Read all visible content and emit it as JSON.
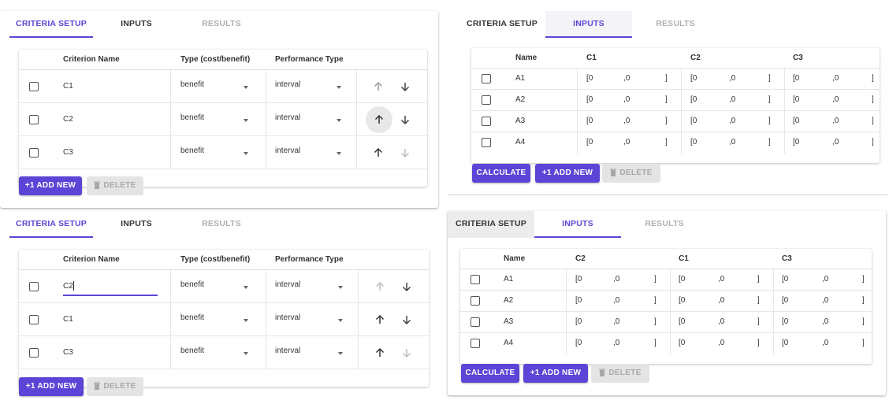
{
  "tabs": {
    "criteria_setup": "CRITERIA SETUP",
    "inputs": "INPUTS",
    "results": "RESULTS"
  },
  "criteria_table": {
    "headers": [
      "Criterion Name",
      "Type (cost/benefit)",
      "Performance Type"
    ]
  },
  "panel_tl": {
    "rows": [
      {
        "name": "C1",
        "type": "benefit",
        "perf": "interval"
      },
      {
        "name": "C2",
        "type": "benefit",
        "perf": "interval"
      },
      {
        "name": "C3",
        "type": "benefit",
        "perf": "interval"
      }
    ]
  },
  "panel_bl": {
    "rows": [
      {
        "name": "C2",
        "type": "benefit",
        "perf": "interval"
      },
      {
        "name": "C1",
        "type": "benefit",
        "perf": "interval"
      },
      {
        "name": "C3",
        "type": "benefit",
        "perf": "interval"
      }
    ]
  },
  "panel_tr": {
    "headers": [
      "Name",
      "C1",
      "C2",
      "C3"
    ],
    "rows": [
      "A1",
      "A2",
      "A3",
      "A4"
    ]
  },
  "panel_br": {
    "headers": [
      "Name",
      "C2",
      "C1",
      "C3"
    ],
    "rows": [
      "A1",
      "A2",
      "A3",
      "A4"
    ]
  },
  "interval": {
    "open": "[0",
    "sep": ",0",
    "close": "]"
  },
  "buttons": {
    "add_new": "+1  ADD NEW",
    "delete": "DELETE",
    "calculate": "CALCULATE"
  },
  "colors": {
    "accent": "#5b45d6",
    "disabled_bg": "#e4e4e4"
  }
}
